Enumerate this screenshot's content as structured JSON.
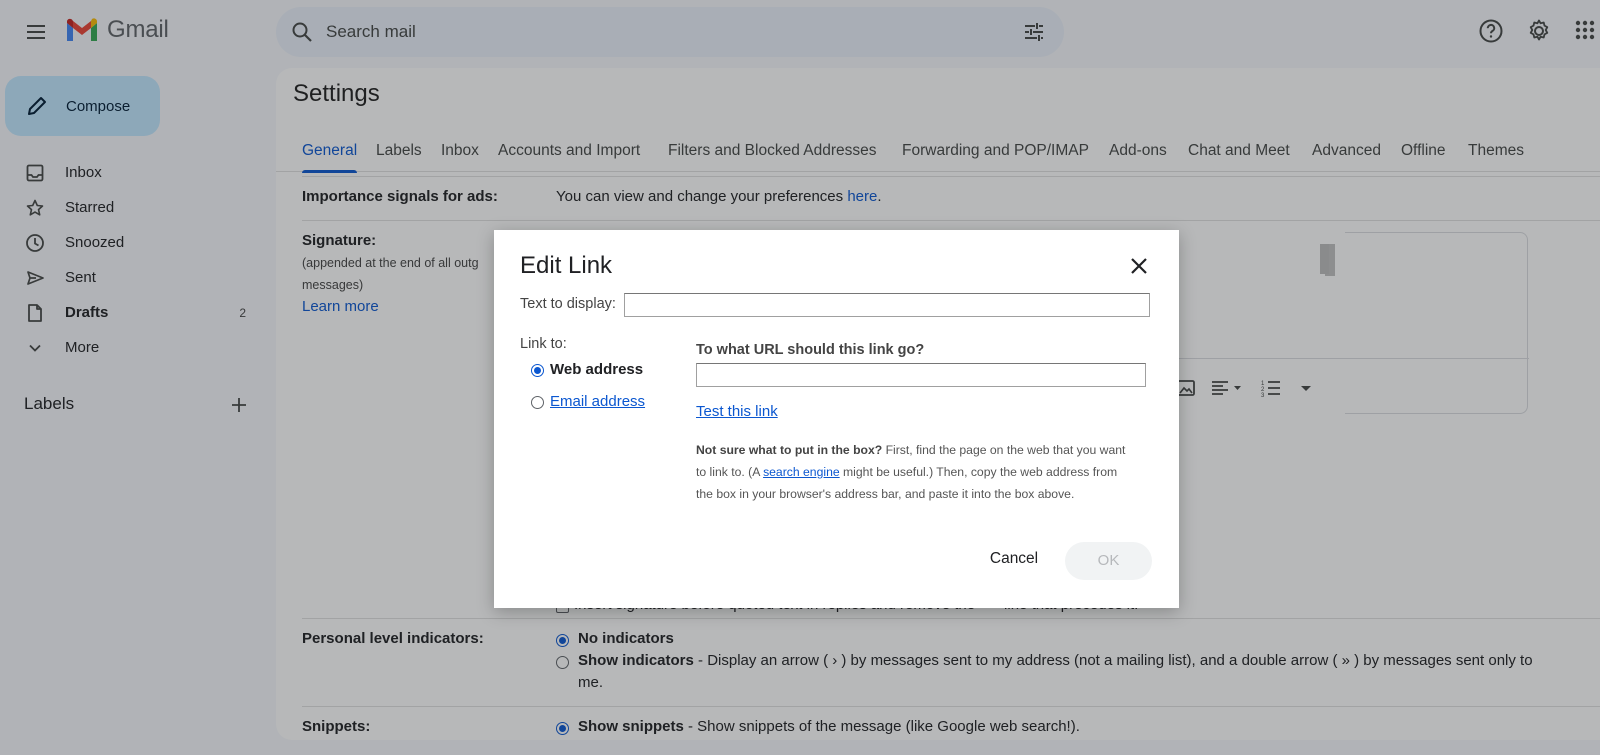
{
  "app": {
    "name": "Gmail"
  },
  "search": {
    "placeholder": "Search mail"
  },
  "sidebar": {
    "compose_label": "Compose",
    "items": [
      {
        "label": "Inbox",
        "icon": "inbox-icon"
      },
      {
        "label": "Starred",
        "icon": "star-icon"
      },
      {
        "label": "Snoozed",
        "icon": "clock-icon"
      },
      {
        "label": "Sent",
        "icon": "send-icon"
      },
      {
        "label": "Drafts",
        "icon": "draft-icon",
        "count": "2"
      },
      {
        "label": "More",
        "icon": "chevron-down-icon"
      }
    ],
    "labels_heading": "Labels"
  },
  "settings": {
    "title": "Settings",
    "tabs": [
      "General",
      "Labels",
      "Inbox",
      "Accounts and Import",
      "Filters and Blocked Addresses",
      "Forwarding and POP/IMAP",
      "Add-ons",
      "Chat and Meet",
      "Advanced",
      "Offline",
      "Themes"
    ],
    "importance": {
      "label": "Importance signals for ads:",
      "text": "You can view and change your preferences ",
      "link": "here",
      "suffix": "."
    },
    "signature": {
      "label": "Signature:",
      "desc_line1": "(appended at the end of all outg",
      "desc_line2": "messages)",
      "learn_more": "Learn more",
      "insert_before": "Insert signature before quoted text in replies and remove the \"--\" line that precedes it."
    },
    "personal_indicators": {
      "label": "Personal level indicators:",
      "no_indicators": "No indicators",
      "show_indicators": "Show indicators",
      "show_indicators_desc_1": " - Display an arrow ( › ) by messages sent to my address (not a mailing list), and a double arrow ( » ) by messages sent only to",
      "show_indicators_desc_2": "me."
    },
    "snippets": {
      "label": "Snippets:",
      "show_snippets": "Show snippets",
      "desc": " - Show snippets of the message (like Google web search!)."
    }
  },
  "dialog": {
    "title": "Edit Link",
    "text_to_display_label": "Text to display:",
    "text_to_display_value": "",
    "link_to_label": "Link to:",
    "web_address": "Web address",
    "email_address": "Email address",
    "url_question": "To what URL should this link go?",
    "url_value": "",
    "test_link": "Test this link",
    "help_bold": "Not sure what to put in the box?",
    "help_text_1": " First, find the page on the web that you want to link to. (A ",
    "help_link": "search engine",
    "help_text_2": " might be useful.) Then, copy the web address from the box in your browser's address bar, and paste it into the box above.",
    "cancel": "Cancel",
    "ok": "OK"
  },
  "colors": {
    "accent": "#0b57d0",
    "compose_bg": "#c2e7ff",
    "search_bg": "#eaf1fb",
    "page_bg": "#f6f8fc"
  }
}
